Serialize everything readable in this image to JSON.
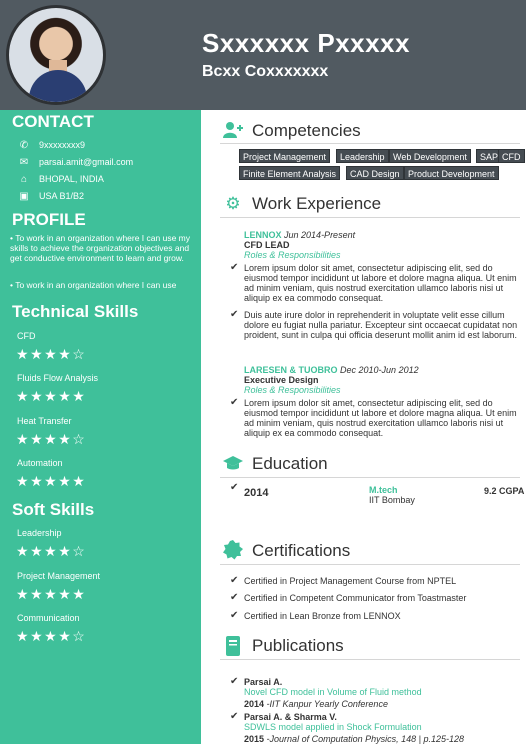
{
  "header": {
    "name": "Sxxxxxx Pxxxxx",
    "title": "Bcxx Coxxxxxxx"
  },
  "sidebar": {
    "contact_heading": "CONTACT",
    "contact": {
      "phone": "9xxxxxxxx9",
      "email": "parsai.amit@gmail.com",
      "location": "BHOPAL, INDIA",
      "visa": "USA B1/B2"
    },
    "profile_heading": "PROFILE",
    "profile": [
      "To work in an organization where I can use my skills to achieve the organization objectives and get conductive environment to learn and grow.",
      "To work in an organization where I can use"
    ],
    "tech_heading": "Technical Skills",
    "tech_skills": [
      {
        "label": "CFD",
        "rating": 4
      },
      {
        "label": "Fluids Flow Analysis",
        "rating": 5
      },
      {
        "label": "Heat Transfer",
        "rating": 4
      },
      {
        "label": "Automation",
        "rating": 5
      }
    ],
    "soft_heading": "Soft Skills",
    "soft_skills": [
      {
        "label": "Leadership",
        "rating": 4
      },
      {
        "label": "Project Management",
        "rating": 5
      },
      {
        "label": "Communication",
        "rating": 4
      }
    ]
  },
  "competencies": {
    "heading": "Competencies",
    "tags": [
      "Project Management",
      "Leadership",
      "Web Development",
      "SAP",
      "CFD",
      "Finite Element Analysis",
      "CAD Design",
      "Product Development"
    ]
  },
  "work": {
    "heading": "Work Experience",
    "jobs": [
      {
        "company": "LENNOX",
        "dates": "Jun 2014-Present",
        "role": "CFD LEAD",
        "resp": "Roles & Responsibilities",
        "bullets": [
          "Lorem ipsum dolor sit amet, consectetur adipiscing elit, sed do eiusmod tempor incididunt ut labore et dolore magna aliqua. Ut enim ad minim veniam, quis nostrud exercitation ullamco laboris nisi ut aliquip ex ea commodo consequat.",
          "Duis aute irure dolor in reprehenderit in voluptate velit esse cillum dolore eu fugiat nulla pariatur. Excepteur sint occaecat cupidatat non proident, sunt in culpa qui officia deserunt mollit anim id est laborum."
        ]
      },
      {
        "company": "LARESEN & TUOBRO",
        "dates": "Dec 2010-Jun 2012",
        "role": "Executive Design",
        "resp": "Roles & Responsibilities",
        "bullets": [
          "Lorem ipsum dolor sit amet, consectetur adipiscing elit, sed do eiusmod tempor incididunt ut labore et dolore magna aliqua. Ut enim ad minim veniam, quis nostrud exercitation ullamco laboris nisi ut aliquip ex ea commodo consequat."
        ]
      }
    ]
  },
  "education": {
    "heading": "Education",
    "year": "2014",
    "degree": "M.tech",
    "institute": "IIT Bombay",
    "gpa": "9.2 CGPA"
  },
  "certifications": {
    "heading": "Certifications",
    "items": [
      "Certified in Project Management Course from NPTEL",
      "Certified in Competent Communicator from Toastmaster",
      "Certified in Lean Bronze from LENNOX"
    ]
  },
  "publications": {
    "heading": "Publications",
    "items": [
      {
        "authors": "Parsai A.",
        "title": "Novel CFD model in Volume of Fluid method",
        "year": "2014",
        "venue": "-IIT Kanpur Yearly Conference"
      },
      {
        "authors": "Parsai A. & Sharma V.",
        "title": "SDWLS model applied in Shock Formulation",
        "year": "2015",
        "venue": "-Journal of Computation Physics, 148 | p.125-128"
      }
    ]
  },
  "colors": {
    "accent": "#3fc09a",
    "header": "#515a61",
    "tag": "#454c52"
  }
}
